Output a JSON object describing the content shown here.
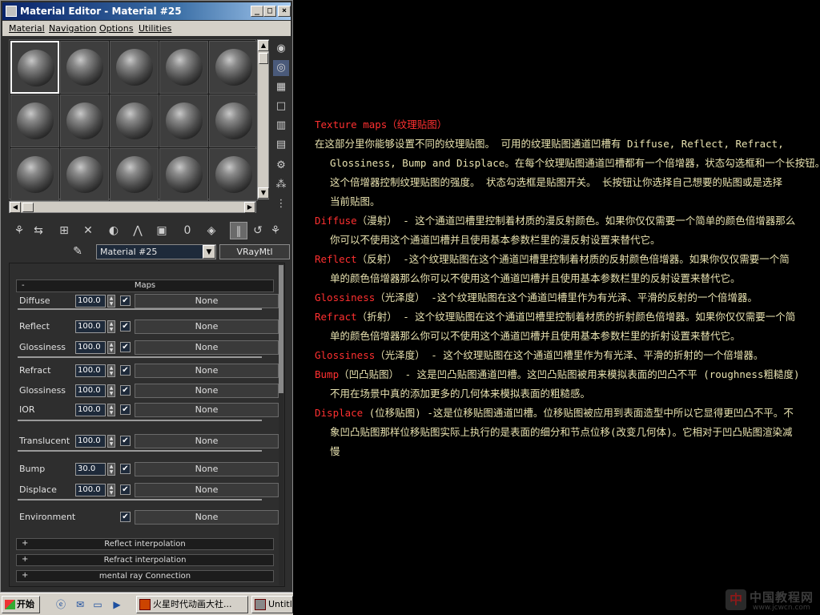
{
  "window": {
    "title": "Material Editor - Material #25",
    "buttons": {
      "minimize": "_",
      "maximize": "□",
      "close": "×"
    }
  },
  "menu": [
    "Material",
    "Navigation",
    "Options",
    "Utilities"
  ],
  "material": {
    "name": "Material #25",
    "type": "VRayMtl"
  },
  "maps": {
    "header": "Maps",
    "collapse_symbol": "-",
    "rows": [
      {
        "label": "Diffuse",
        "value": "100.0",
        "checked": true,
        "map": "None"
      },
      {
        "label": "Reflect",
        "value": "100.0",
        "checked": true,
        "map": "None"
      },
      {
        "label": "Glossiness",
        "value": "100.0",
        "checked": true,
        "map": "None"
      },
      {
        "label": "Refract",
        "value": "100.0",
        "checked": true,
        "map": "None"
      },
      {
        "label": "Glossiness",
        "value": "100.0",
        "checked": true,
        "map": "None"
      },
      {
        "label": "IOR",
        "value": "100.0",
        "checked": true,
        "map": "None"
      },
      {
        "label": "Translucent",
        "value": "100.0",
        "checked": true,
        "map": "None"
      },
      {
        "label": "Bump",
        "value": "30.0",
        "checked": true,
        "map": "None"
      },
      {
        "label": "Displace",
        "value": "100.0",
        "checked": true,
        "map": "None"
      },
      {
        "label": "Environment",
        "value": "",
        "checked": true,
        "map": "None"
      }
    ],
    "check_mark": "✔"
  },
  "rollouts": [
    {
      "symbol": "+",
      "label": "Reflect interpolation"
    },
    {
      "symbol": "+",
      "label": "Refract interpolation"
    },
    {
      "symbol": "+",
      "label": "mental ray Connection"
    }
  ],
  "taskbar": {
    "start_label": "开始",
    "items": [
      "火星时代动画大社...",
      "Untitle"
    ]
  },
  "doc": {
    "paragraphs": [
      {
        "lines": [
          [
            {
              "t": "Texture maps（纹理贴图）",
              "red": true
            }
          ]
        ]
      },
      {
        "lines": [
          [
            {
              "t": "在这部分里你能够设置不同的纹理贴图。 可用的纹理贴图通道凹槽有 Diffuse, Reflect, Refract,"
            }
          ],
          [
            {
              "t": "Glossiness, Bump and Displace。在每个纹理贴图通道凹槽都有一个倍增器，状态勾选框和一个长按钮。"
            }
          ],
          [
            {
              "t": "这个倍增器控制纹理贴图的强度。 状态勾选框是贴图开关。 长按钮让你选择自己想要的贴图或是选择"
            }
          ],
          [
            {
              "t": "当前贴图。"
            }
          ]
        ]
      },
      {
        "lines": [
          [
            {
              "t": "Diffuse",
              "red": true
            },
            {
              "t": "（漫射） - 这个通道凹槽里控制着材质的漫反射颜色。如果你仅仅需要一个简单的颜色倍增器那么"
            }
          ],
          [
            {
              "t": "你可以不使用这个通道凹槽并且使用基本参数栏里的漫反射设置来替代它。"
            }
          ]
        ]
      },
      {
        "lines": [
          [
            {
              "t": "Reflect",
              "red": true
            },
            {
              "t": "（反射） -这个纹理贴图在这个通道凹槽里控制着材质的反射颜色倍增器。如果你仅仅需要一个简"
            }
          ],
          [
            {
              "t": "单的颜色倍增器那么你可以不使用这个通道凹槽并且使用基本参数栏里的反射设置来替代它。"
            }
          ]
        ]
      },
      {
        "lines": [
          [
            {
              "t": "Glossiness",
              "red": true
            },
            {
              "t": "（光泽度） -这个纹理贴图在这个通道凹槽里作为有光泽、平滑的反射的一个倍增器。"
            }
          ]
        ]
      },
      {
        "lines": [
          [
            {
              "t": "Refract",
              "red": true
            },
            {
              "t": "（折射） - 这个纹理贴图在这个通道凹槽里控制着材质的折射颜色倍增器。如果你仅仅需要一个简"
            }
          ],
          [
            {
              "t": "单的颜色倍增器那么你可以不使用这个通道凹槽并且使用基本参数栏里的折射设置来替代它。"
            }
          ]
        ]
      },
      {
        "lines": [
          [
            {
              "t": "Glossiness",
              "red": true
            },
            {
              "t": "（光泽度） - 这个纹理贴图在这个通道凹槽里作为有光泽、平滑的折射的一个倍增器。"
            }
          ]
        ]
      },
      {
        "lines": [
          [
            {
              "t": "Bump",
              "red": true
            },
            {
              "t": "（凹凸贴图） - 这是凹凸贴图通道凹槽。这凹凸贴图被用来模拟表面的凹凸不平 (roughness粗糙度)"
            }
          ],
          [
            {
              "t": "不用在场景中真的添加更多的几何体来模拟表面的粗糙感。"
            }
          ]
        ]
      },
      {
        "lines": [
          [
            {
              "t": "Displace",
              "red": true
            },
            {
              "t": " (位移贴图) -这是位移贴图通道凹槽。位移贴图被应用到表面造型中所以它显得更凹凸不平。不"
            }
          ],
          [
            {
              "t": "象凹凸贴图那样位移贴图实际上执行的是表面的细分和节点位移(改变几何体)。它相对于凹凸贴图渲染减"
            }
          ],
          [
            {
              "t": "慢"
            }
          ]
        ]
      }
    ]
  },
  "watermark": {
    "line1": "中国教程网",
    "line2": "www.jcwcn.com"
  },
  "icons": {
    "sample_slot": "sphere-icon",
    "side_tools": [
      "sample-type-icon",
      "backlight-icon",
      "background-checker-icon",
      "sample-uv-icon",
      "video-check-icon",
      "make-preview-icon",
      "options-icon",
      "select-by-material-icon",
      "material-navigator-icon"
    ],
    "toolbar": [
      "get-material-icon",
      "put-to-scene-icon",
      "assign-to-selection-icon",
      "reset-map-icon",
      "make-copy-icon",
      "make-unique-icon",
      "put-to-library-icon",
      "material-id-icon",
      "show-map-icon",
      "show-end-result-icon",
      "go-to-parent-icon",
      "go-forward-sibling-icon"
    ]
  },
  "colors": {
    "doc_text": "#e8e2b0",
    "doc_accent": "#ff3030",
    "title_bar": "#0a246a"
  }
}
